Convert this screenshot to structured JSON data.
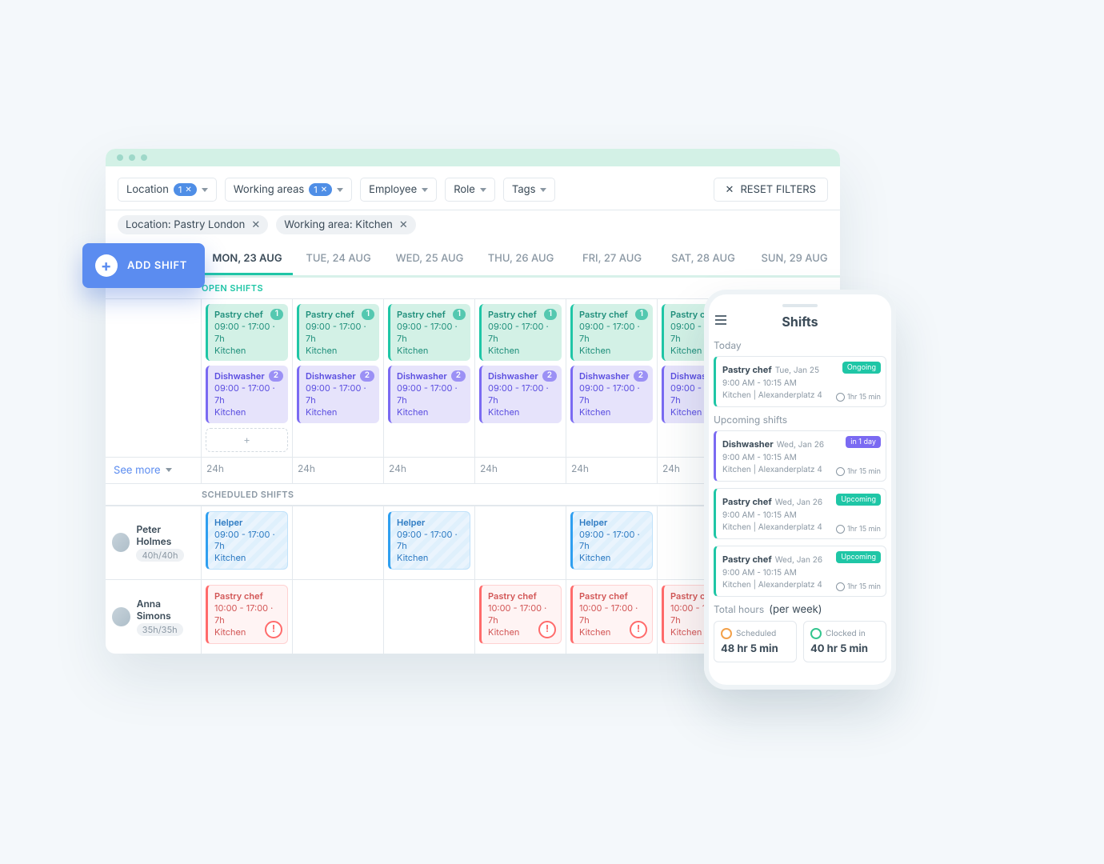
{
  "addShift": "ADD SHIFT",
  "filters": {
    "location": "Location",
    "location_count": "1",
    "working_areas": "Working areas",
    "working_areas_count": "1",
    "employee": "Employee",
    "role": "Role",
    "tags": "Tags",
    "reset": "RESET FILTERS"
  },
  "chips": {
    "location": "Location: Pastry London",
    "area": "Working area: Kitchen"
  },
  "days": [
    "MON, 23 AUG",
    "TUE, 24 AUG",
    "WED, 25 AUG",
    "THU, 26 AUG",
    "FRI, 27 AUG",
    "SAT, 28 AUG",
    "SUN, 29 AUG"
  ],
  "sections": {
    "open": "OPEN SHIFTS",
    "scheduled": "SCHEDULED SHIFTS"
  },
  "open": {
    "pastry": {
      "title": "Pastry chef",
      "meta": "09:00 - 17:00 · 7h",
      "area": "Kitchen",
      "count": "1"
    },
    "dish": {
      "title": "Dishwasher",
      "meta": "09:00 - 17:00 · 7h",
      "area": "Kitchen",
      "count": "2"
    }
  },
  "seeMore": "See more",
  "dayTotal": "24h",
  "employees": [
    {
      "name": "Peter Holmes",
      "hours": "40h/40h"
    },
    {
      "name": "Anna Simons",
      "hours": "35h/35h"
    }
  ],
  "helper": {
    "title": "Helper",
    "meta": "09:00 - 17:00 · 7h",
    "area": "Kitchen"
  },
  "annaShift": {
    "title": "Pastry chef",
    "meta": "10:00 - 17:00 · 7h",
    "area": "Kitchen"
  },
  "phone": {
    "title": "Shifts",
    "today": "Today",
    "upcoming": "Upcoming shifts",
    "totals": "Total hours",
    "perweek": "(per week)",
    "sched": "Scheduled",
    "schedVal": "48 hr 5 min",
    "clock": "Clocked in",
    "clockVal": "40 hr 5 min",
    "cards": {
      "a": {
        "role": "Pastry chef",
        "date": "Tue, Jan 25",
        "time": "9:00 AM - 10:15 AM",
        "loc": "Kitchen | Alexanderplatz 4",
        "tag": "Ongoing",
        "dur": "1hr 15 min"
      },
      "b": {
        "role": "Dishwasher",
        "date": "Wed, Jan 26",
        "time": "9:00 AM - 10:15 AM",
        "loc": "Kitchen | Alexanderplatz 4",
        "tag": "in 1 day",
        "dur": "1hr 15 min"
      },
      "c": {
        "role": "Pastry chef",
        "date": "Wed, Jan 26",
        "time": "9:00 AM - 10:15 AM",
        "loc": "Kitchen | Alexanderplatz 4",
        "tag": "Upcoming",
        "dur": "1hr 15 min"
      },
      "d": {
        "role": "Pastry chef",
        "date": "Wed, Jan 26",
        "time": "9:00 AM - 10:15 AM",
        "loc": "Kitchen | Alexanderplatz 4",
        "tag": "Upcoming",
        "dur": "1hr 15 min"
      }
    }
  }
}
